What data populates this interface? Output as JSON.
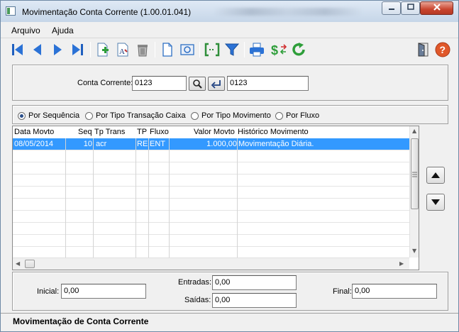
{
  "window": {
    "title": "Movimentação Conta Corrente (1.00.01.041)",
    "accent": "#3399ff"
  },
  "menu": {
    "arquivo": "Arquivo",
    "ajuda": "Ajuda"
  },
  "toolbar": {
    "icons": [
      "first-record-icon",
      "previous-record-icon",
      "next-record-icon",
      "last-record-icon",
      "new-document-icon",
      "edit-text-icon",
      "trash-icon",
      "blank-page-icon",
      "preview-icon",
      "bracket-range-icon",
      "filter-icon",
      "printer-icon",
      "currency-exchange-icon",
      "refresh-icon",
      "exit-door-icon",
      "help-icon"
    ]
  },
  "search": {
    "label": "Conta Corrente:",
    "code_value": "0123",
    "result_value": "0123"
  },
  "sort_options": {
    "selected": "por_sequencia",
    "items": [
      {
        "id": "por_sequencia",
        "label": "Por Sequência"
      },
      {
        "id": "por_tipo_transacao",
        "label": "Por Tipo Transação Caixa"
      },
      {
        "id": "por_tipo_movimento",
        "label": "Por Tipo Movimento"
      },
      {
        "id": "por_fluxo",
        "label": "Por Fluxo"
      }
    ]
  },
  "grid": {
    "columns": [
      "Data Movto",
      "Seq",
      "Tp Trans",
      "TP",
      "Fluxo",
      "Valor Movto",
      "Histórico Movimento"
    ],
    "rows": [
      {
        "data": "08/05/2014",
        "seq": "10",
        "tp_trans": "acr",
        "tp": "RE",
        "fluxo": "ENT",
        "valor": "1.000,00",
        "historico": "Movimentação Diária."
      }
    ]
  },
  "totals": {
    "inicial_label": "Inicial:",
    "inicial_value": "0,00",
    "entradas_label": "Entradas:",
    "entradas_value": "0,00",
    "saidas_label": "Saídas:",
    "saidas_value": "0,00",
    "final_label": "Final:",
    "final_value": "0,00"
  },
  "status": {
    "text": "Movimentação de Conta Corrente"
  }
}
